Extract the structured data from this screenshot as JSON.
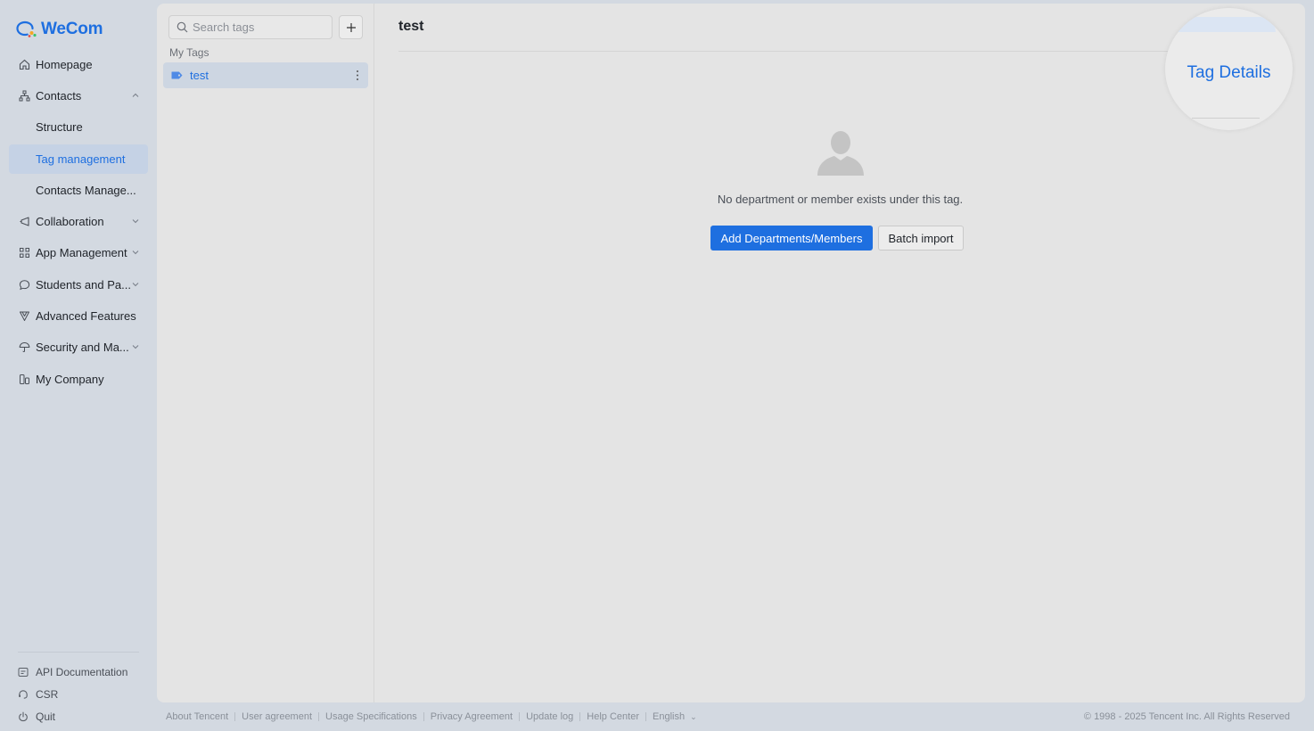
{
  "app": {
    "logo_text": "WeCom",
    "brand_color": "#1e6fe0"
  },
  "sidebar": {
    "items": [
      {
        "label": "Homepage",
        "icon": "home-icon"
      },
      {
        "label": "Contacts",
        "icon": "org-chart-icon",
        "expanded": true
      },
      {
        "label": "Structure"
      },
      {
        "label": "Tag management",
        "active": true
      },
      {
        "label": "Contacts Manage..."
      },
      {
        "label": "Collaboration",
        "icon": "collaboration-icon"
      },
      {
        "label": "App Management",
        "icon": "apps-grid-icon"
      },
      {
        "label": "Students and Pa...",
        "icon": "chat-bubble-icon"
      },
      {
        "label": "Advanced Features",
        "icon": "advanced-features-icon"
      },
      {
        "label": "Security and Ma...",
        "icon": "umbrella-icon"
      },
      {
        "label": "My Company",
        "icon": "company-building-icon"
      }
    ],
    "footer": [
      {
        "label": "API Documentation",
        "icon": "api-doc-icon"
      },
      {
        "label": "CSR",
        "icon": "headset-icon"
      },
      {
        "label": "Quit",
        "icon": "power-icon"
      }
    ]
  },
  "tags_pane": {
    "search_placeholder": "Search tags",
    "section_label": "My Tags",
    "tags": [
      {
        "name": "test"
      }
    ]
  },
  "detail": {
    "title": "test",
    "empty_text": "No department or member exists under this tag.",
    "primary_button": "Add Departments/Members",
    "secondary_button": "Batch import"
  },
  "magnifier": {
    "text": "Tag Details"
  },
  "footer": {
    "links": [
      "About Tencent",
      "User agreement",
      "Usage Specifications",
      "Privacy Agreement",
      "Update log",
      "Help Center",
      "English"
    ],
    "copyright": "© 1998 - 2025 Tencent Inc. All Rights Reserved"
  }
}
